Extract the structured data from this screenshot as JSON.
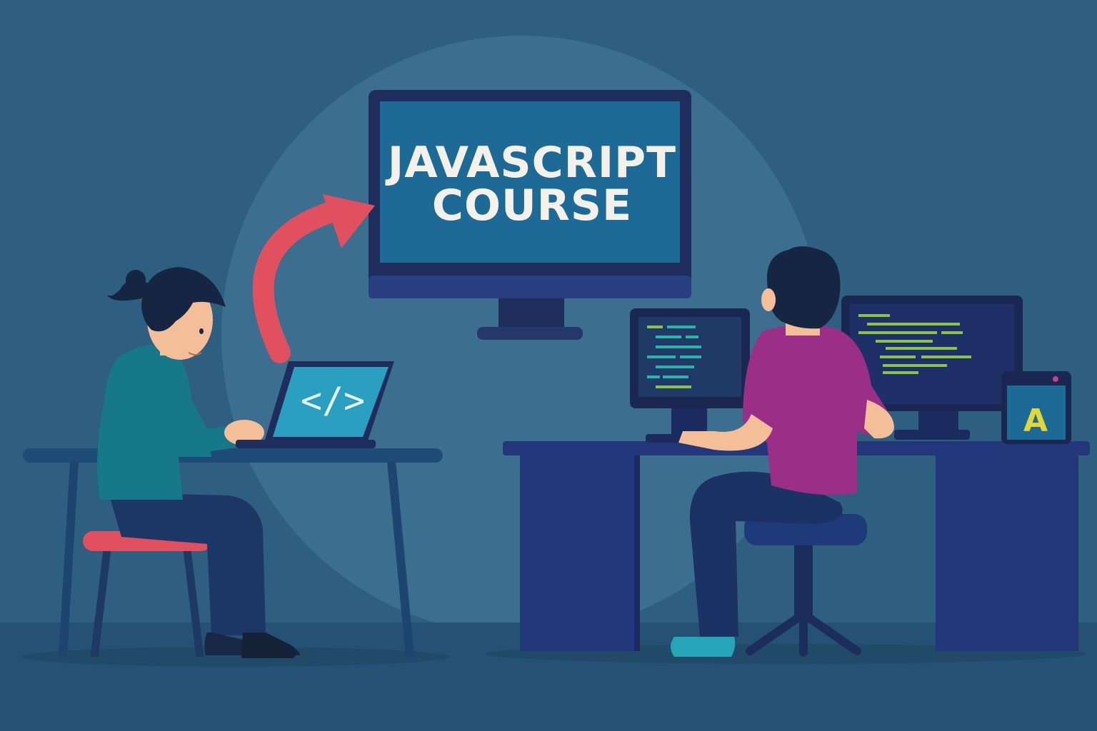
{
  "big_monitor": {
    "title_line1": "JAVASCRIPT",
    "title_line2": "COURSE"
  },
  "laptop": {
    "screen_glyph": "</>"
  },
  "tablet": {
    "letter": "A"
  },
  "colors": {
    "background": "#2e5f80",
    "spotlight": "#3b6e8f",
    "floor": "#255274",
    "accent_red": "#e0505f",
    "screen_blue": "#1d6a97",
    "frame_navy": "#1e2d5c",
    "desk_blue": "#24377a",
    "code_green": "#8bc34a",
    "code_teal": "#26b5a6",
    "shirt_purple": "#9b2f87",
    "sweater_teal": "#17788a",
    "tablet_yellow": "#e3d63a"
  },
  "icons": [
    "code-icon",
    "arrow-icon"
  ]
}
